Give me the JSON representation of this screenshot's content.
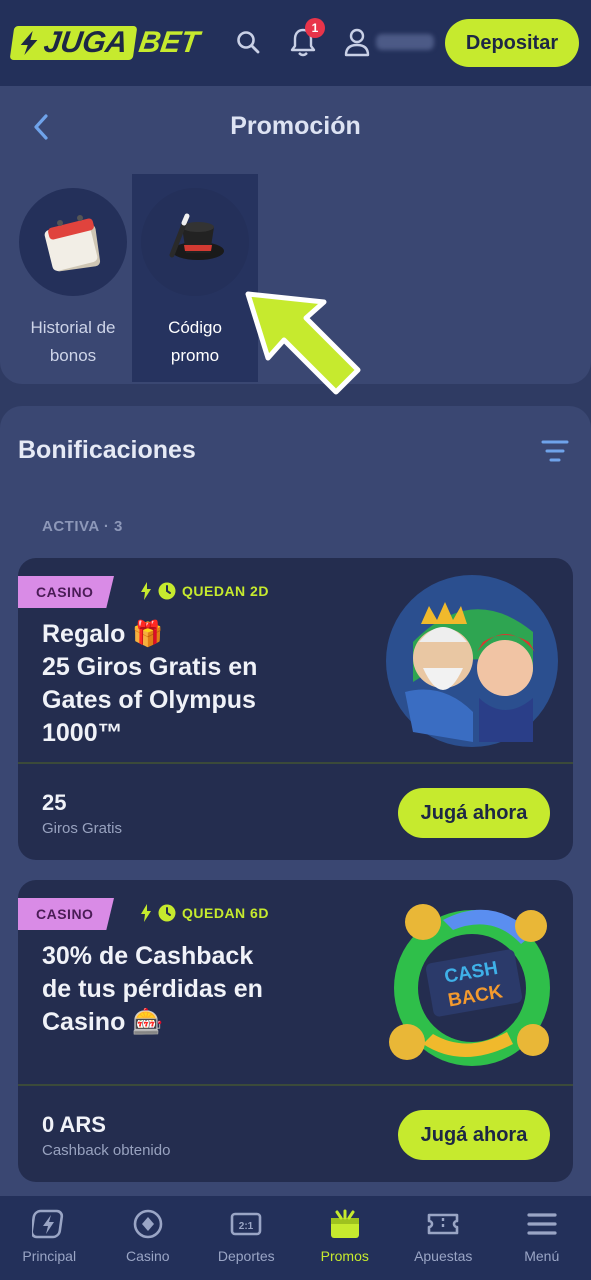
{
  "header": {
    "logo_part1": "JUGA",
    "logo_part2": "BET",
    "notification_count": "1",
    "deposit_label": "Depositar"
  },
  "promo": {
    "title": "Promoción",
    "shortcuts": [
      {
        "label_line1": "Historial de",
        "label_line2": "bonos",
        "icon": "calendar-icon"
      },
      {
        "label_line1": "Código",
        "label_line2": "promo",
        "icon": "magic-hat-icon",
        "selected": true
      }
    ]
  },
  "bonuses": {
    "title": "Bonificaciones",
    "active_label": "ACTIVA · 3",
    "cards": [
      {
        "tag": "CASINO",
        "timer": "QUEDAN 2D",
        "title_lines": [
          "Regalo 🎁",
          "25 Giros Gratis en",
          "Gates of Olympus",
          "1000™"
        ],
        "amount": "25",
        "amount_sub": "Giros Gratis",
        "button": "Jugá ahora"
      },
      {
        "tag": "CASINO",
        "timer": "QUEDAN 6D",
        "title_lines": [
          "30% de Cashback",
          "de tus pérdidas en",
          "Casino 🎰"
        ],
        "art_text": "CASH BACK",
        "amount": "0 ARS",
        "amount_sub": "Cashback obtenido",
        "button": "Jugá ahora"
      }
    ]
  },
  "nav": [
    {
      "label": "Principal",
      "icon": "home-bolt-icon"
    },
    {
      "label": "Casino",
      "icon": "casino-chip-icon"
    },
    {
      "label": "Deportes",
      "icon": "scoreboard-icon"
    },
    {
      "label": "Promos",
      "icon": "gift-icon",
      "active": true
    },
    {
      "label": "Apuestas",
      "icon": "ticket-icon"
    },
    {
      "label": "Menú",
      "icon": "hamburger-icon"
    }
  ],
  "colors": {
    "accent": "#c6ea2e",
    "background": "#2f3b63",
    "header": "#23305a",
    "card": "#242d4f",
    "tag": "#d98be6"
  }
}
